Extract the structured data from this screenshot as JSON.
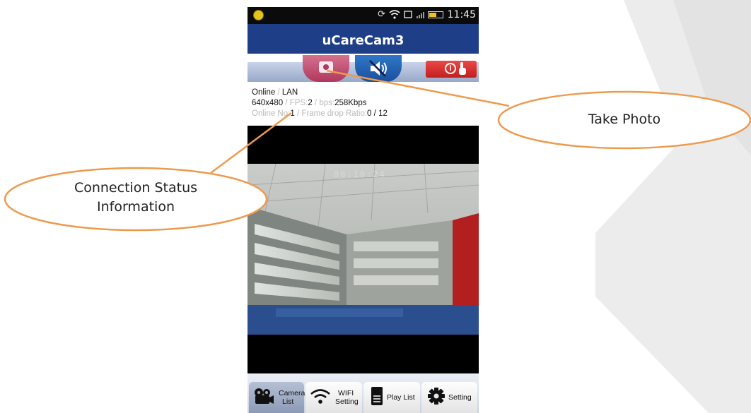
{
  "status_bar": {
    "time": "11:45"
  },
  "app": {
    "title": "uCareCam3"
  },
  "connection": {
    "status": "Online",
    "network": "LAN",
    "resolution": "640x480",
    "fps_label": "FPS",
    "fps_value": "2",
    "bps_label": "bps",
    "bps_value": "258Kbps",
    "online_no_label": "Online No",
    "online_no_value": "1",
    "frame_drop_label": "Frame drop Ratio",
    "frame_drop_value": "0",
    "frame_drop_total": "12",
    "separator": "/"
  },
  "video": {
    "timestamp": "08:10:24"
  },
  "tabs": [
    {
      "label_line1": "Camera",
      "label_line2": "List",
      "icon": "film-camera-icon",
      "active": true
    },
    {
      "label_line1": "WIFI",
      "label_line2": "Setting",
      "icon": "wifi-icon",
      "active": false
    },
    {
      "label_line1": "Play List",
      "label_line2": "",
      "icon": "document-icon",
      "active": false
    },
    {
      "label_line1": "Setting",
      "label_line2": "",
      "icon": "gear-icon",
      "active": false
    }
  ],
  "annotations": {
    "take_photo": "Take Photo",
    "connection_line1": "Connection Status",
    "connection_line2": "Information"
  },
  "colors": {
    "annotation_orange": "#EE9A4D",
    "app_bar_blue": "#1E3F88",
    "photo_button_pink": "#C44A6F",
    "info_button_red": "#D92E2D"
  }
}
